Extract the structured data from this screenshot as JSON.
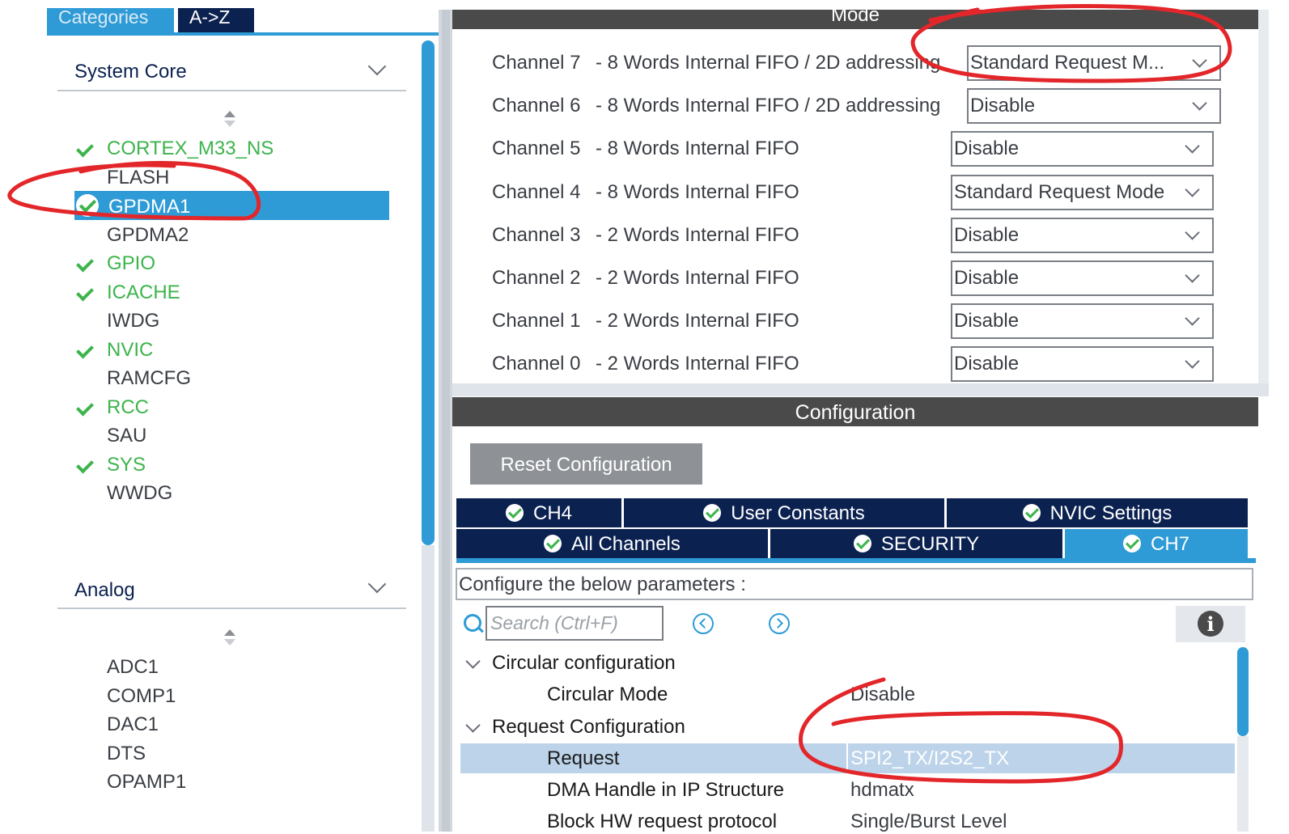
{
  "left_panel": {
    "tabs": [
      {
        "label": "Categories",
        "active": true
      },
      {
        "label": "A->Z",
        "active": false
      }
    ],
    "system_core": {
      "title": "System Core",
      "items": [
        {
          "label": "CORTEX_M33_NS",
          "enabled": true
        },
        {
          "label": "FLASH",
          "enabled": false
        },
        {
          "label": "GPDMA1",
          "enabled": true,
          "selected": true
        },
        {
          "label": "GPDMA2",
          "enabled": false
        },
        {
          "label": "GPIO",
          "enabled": true
        },
        {
          "label": "ICACHE",
          "enabled": true
        },
        {
          "label": "IWDG",
          "enabled": false
        },
        {
          "label": "NVIC",
          "enabled": true
        },
        {
          "label": "RAMCFG",
          "enabled": false
        },
        {
          "label": "RCC",
          "enabled": true
        },
        {
          "label": "SAU",
          "enabled": false
        },
        {
          "label": "SYS",
          "enabled": true
        },
        {
          "label": "WWDG",
          "enabled": false
        }
      ]
    },
    "analog": {
      "title": "Analog",
      "items": [
        {
          "label": "ADC1"
        },
        {
          "label": "COMP1"
        },
        {
          "label": "DAC1"
        },
        {
          "label": "DTS"
        },
        {
          "label": "OPAMP1"
        }
      ]
    }
  },
  "mode_panel": {
    "title": "Mode",
    "channels": [
      {
        "name": "Channel 7",
        "desc": "- 8 Words Internal FIFO / 2D addressing",
        "value": "Standard Request M..."
      },
      {
        "name": "Channel 6",
        "desc": "- 8 Words Internal FIFO / 2D addressing",
        "value": "Disable"
      },
      {
        "name": "Channel 5",
        "desc": "- 8 Words Internal FIFO",
        "value": "Disable"
      },
      {
        "name": "Channel 4",
        "desc": "- 8 Words Internal FIFO",
        "value": "Standard Request Mode"
      },
      {
        "name": "Channel 3",
        "desc": "- 2 Words Internal FIFO",
        "value": "Disable"
      },
      {
        "name": "Channel 2",
        "desc": "- 2 Words Internal FIFO",
        "value": "Disable"
      },
      {
        "name": "Channel 1",
        "desc": "- 2 Words Internal FIFO",
        "value": "Disable"
      },
      {
        "name": "Channel 0",
        "desc": "- 2 Words Internal FIFO",
        "value": "Disable"
      }
    ]
  },
  "config_panel": {
    "title": "Configuration",
    "reset_label": "Reset Configuration",
    "tabs_row1": [
      "CH4",
      "User Constants",
      "NVIC Settings"
    ],
    "tabs_row2": [
      "All Channels",
      "SECURITY",
      "CH7"
    ],
    "active_tab": "CH7",
    "params_label": "Configure the below parameters :",
    "search_placeholder": "Search (Ctrl+F)",
    "tree": [
      {
        "group": "Circular configuration",
        "rows": [
          {
            "key": "Circular Mode",
            "value": "Disable"
          }
        ]
      },
      {
        "group": "Request Configuration",
        "rows": [
          {
            "key": "Request",
            "value": "SPI2_TX/I2S2_TX",
            "selected": true
          },
          {
            "key": "DMA Handle in IP Structure",
            "value": "hdmatx"
          },
          {
            "key": "Block HW request protocol",
            "value": "Single/Burst Level"
          }
        ]
      }
    ]
  },
  "colors": {
    "accent": "#2e9bd6",
    "navy": "#0b2150",
    "enabled_green": "#3cb44b",
    "header_gray": "#4a4a4a",
    "annotation_red": "#e3262a"
  },
  "icons": [
    "check-icon",
    "chevron-down-icon",
    "sort-icon",
    "search-icon",
    "prev-icon",
    "next-icon",
    "info-icon"
  ]
}
